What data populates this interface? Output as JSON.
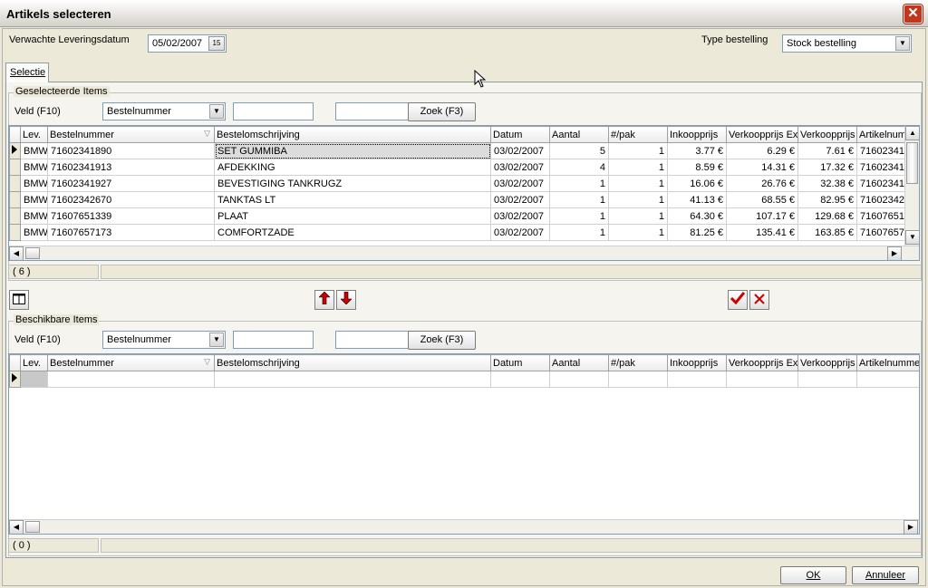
{
  "window": {
    "title": "Artikels selecteren",
    "close_glyph": "✕"
  },
  "header": {
    "delivery_label": "Verwachte Leveringsdatum",
    "delivery_value": "05/02/2007",
    "calendar_glyph": "15",
    "type_label": "Type bestelling",
    "type_value": "Stock bestelling"
  },
  "tabs": [
    {
      "label": "Selectie"
    }
  ],
  "selected": {
    "group_title": "Geselecteerde Items",
    "field_label": "Veld (F10)",
    "field_value": "Bestelnummer",
    "search_button": "Zoek (F3)",
    "columns": [
      "Lev.",
      "Bestelnummer",
      "Bestelomschrijving",
      "Datum",
      "Aantal",
      "#/pak",
      "Inkoopprijs",
      "Verkoopprijs Ex",
      "Verkoopprijs",
      "Artikelnum"
    ],
    "rows": [
      [
        "BMW",
        "71602341890",
        "SET GUMMIBA",
        "03/02/2007",
        "5",
        "1",
        "3.77 €",
        "6.29 €",
        "7.61 €",
        "71602341"
      ],
      [
        "BMW",
        "71602341913",
        "AFDEKKING",
        "03/02/2007",
        "4",
        "1",
        "8.59 €",
        "14.31 €",
        "17.32 €",
        "71602341"
      ],
      [
        "BMW",
        "71602341927",
        "BEVESTIGING TANKRUGZ",
        "03/02/2007",
        "1",
        "1",
        "16.06 €",
        "26.76 €",
        "32.38 €",
        "71602341"
      ],
      [
        "BMW",
        "71602342670",
        "TANKTAS LT",
        "03/02/2007",
        "1",
        "1",
        "41.13 €",
        "68.55 €",
        "82.95 €",
        "71602342"
      ],
      [
        "BMW",
        "71607651339",
        "PLAAT",
        "03/02/2007",
        "1",
        "1",
        "64.30 €",
        "107.17 €",
        "129.68 €",
        "71607651"
      ],
      [
        "BMW",
        "71607657173",
        "COMFORTZADE",
        "03/02/2007",
        "1",
        "1",
        "81.25 €",
        "135.41 €",
        "163.85 €",
        "71607657"
      ]
    ],
    "count": "( 6 )"
  },
  "available": {
    "group_title": "Beschikbare Items",
    "field_label": "Veld (F10)",
    "field_value": "Bestelnummer",
    "search_button": "Zoek (F3)",
    "columns": [
      "Lev.",
      "Bestelnummer",
      "Bestelomschrijving",
      "Datum",
      "Aantal",
      "#/pak",
      "Inkoopprijs",
      "Verkoopprijs Ex",
      "Verkoopprijs",
      "Artikelnummer"
    ],
    "count": "( 0 )"
  },
  "footer": {
    "ok": "OK",
    "cancel": "Annuleer"
  },
  "colors": {
    "accent_red": "#cc0000",
    "close_red": "#c1361c",
    "grid_border": "#7f9db9"
  }
}
